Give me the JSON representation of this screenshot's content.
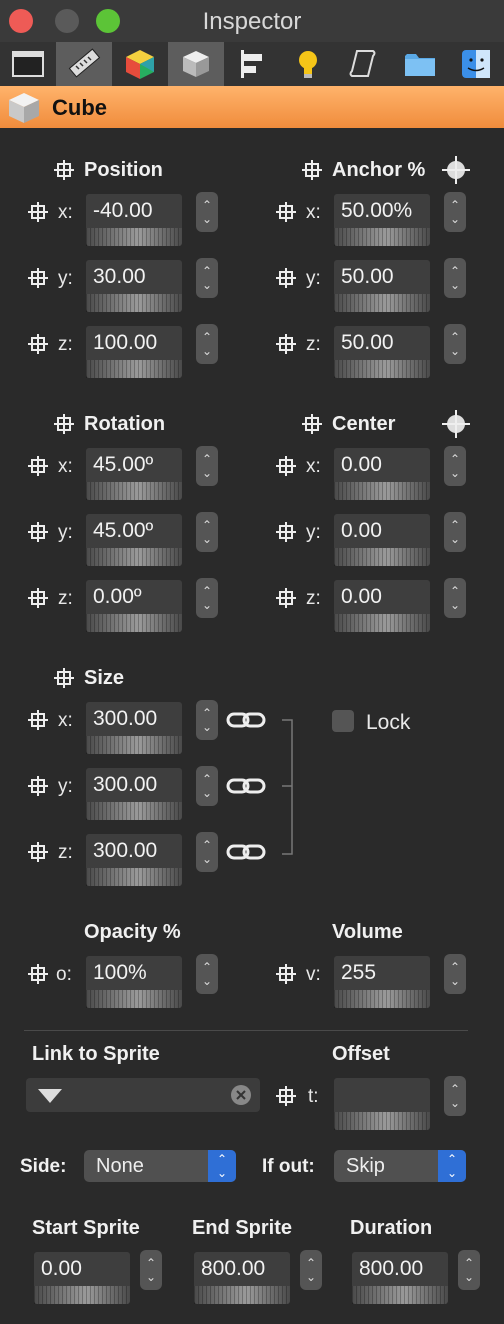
{
  "window": {
    "title": "Inspector"
  },
  "toolbar": {
    "icons": [
      "window-icon",
      "ruler-icon",
      "color-cube-icon",
      "cube-icon",
      "align-icon",
      "bulb-icon",
      "script-icon",
      "folder-icon",
      "finder-icon"
    ]
  },
  "object": {
    "name": "Cube"
  },
  "position": {
    "title": "Position",
    "x": "-40.00",
    "y": "30.00",
    "z": "100.00"
  },
  "anchor": {
    "title": "Anchor %",
    "x": "50.00%",
    "y": "50.00",
    "z": "50.00"
  },
  "rotation": {
    "title": "Rotation",
    "x": "45.00º",
    "y": "45.00º",
    "z": "0.00º"
  },
  "center": {
    "title": "Center",
    "x": "0.00",
    "y": "0.00",
    "z": "0.00"
  },
  "size": {
    "title": "Size",
    "x": "300.00",
    "y": "300.00",
    "z": "300.00",
    "lock_label": "Lock"
  },
  "opacity": {
    "title": "Opacity %",
    "label": "o:",
    "value": "100%"
  },
  "volume": {
    "title": "Volume",
    "label": "v:",
    "value": "255"
  },
  "axis": {
    "x": "x:",
    "y": "y:",
    "z": "z:",
    "t": "t:"
  },
  "link": {
    "title": "Link to Sprite",
    "offset_title": "Offset",
    "offset_value": ""
  },
  "side": {
    "label": "Side:",
    "value": "None"
  },
  "ifout": {
    "label": "If out:",
    "value": "Skip"
  },
  "timing": {
    "start_title": "Start Sprite",
    "start": "0.00",
    "end_title": "End Sprite",
    "end": "800.00",
    "duration_title": "Duration",
    "duration": "800.00"
  },
  "colors": {
    "accent_header": "#f39a48",
    "popup_arrows": "#2f6fd6"
  }
}
